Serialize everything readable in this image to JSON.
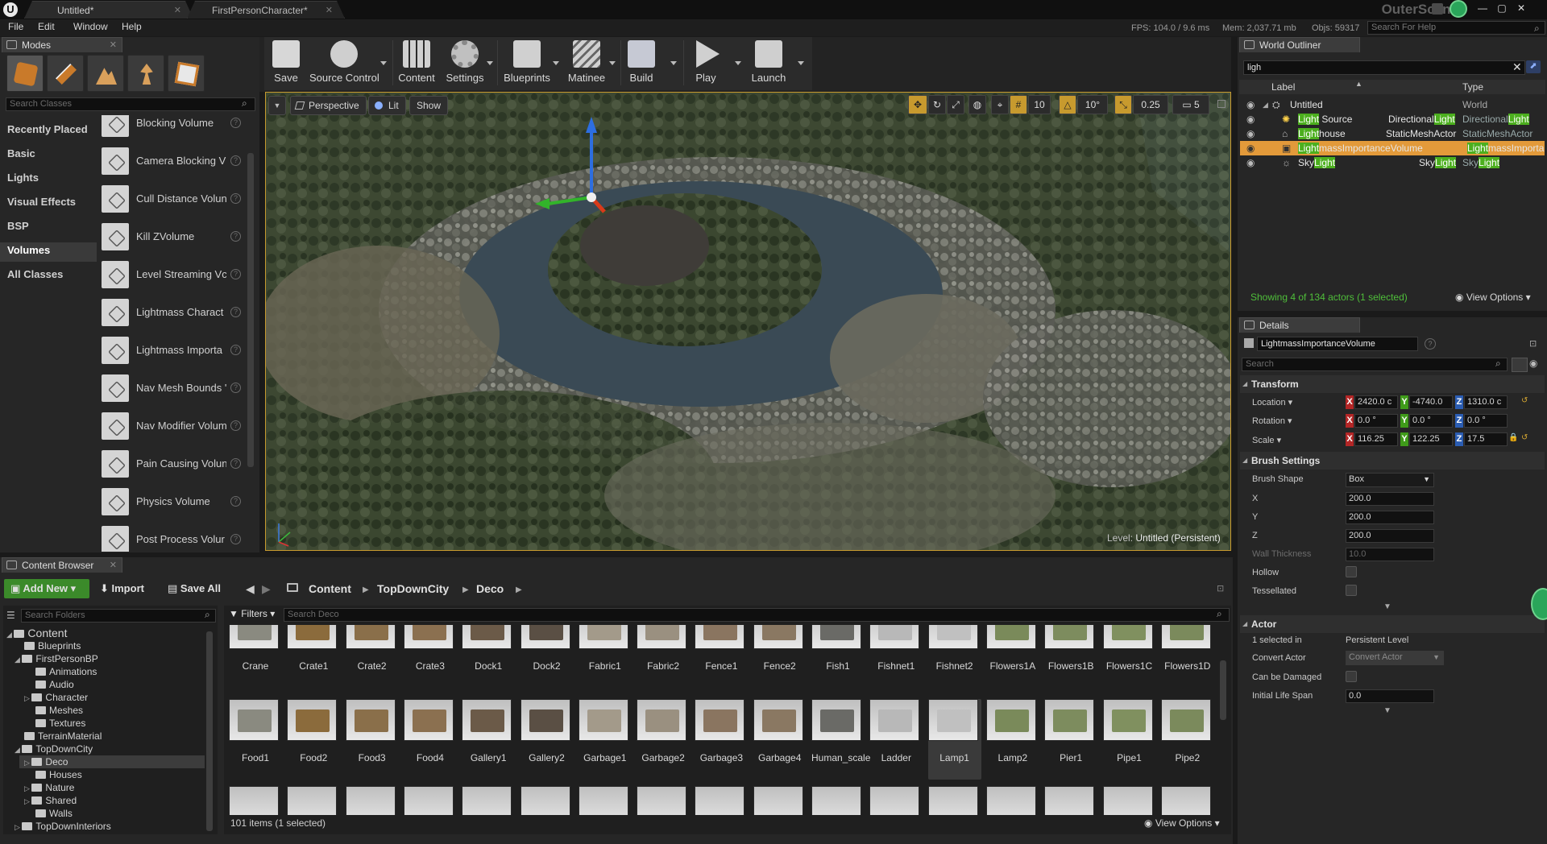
{
  "window": {
    "tabs": [
      "Untitled*",
      "FirstPersonCharacter*"
    ],
    "scene_name": "OuterScene",
    "controls": [
      "—",
      "▢",
      "✕"
    ]
  },
  "menu": [
    "File",
    "Edit",
    "Window",
    "Help"
  ],
  "stats": {
    "fps": "FPS: 104.0 / 9.6 ms",
    "mem": "Mem: 2,037.71 mb",
    "objs": "Objs: 59317"
  },
  "help_search": {
    "placeholder": "Search For Help"
  },
  "modes": {
    "tab": "Modes",
    "search_placeholder": "Search Classes",
    "categories": [
      "Recently Placed",
      "Basic",
      "Lights",
      "Visual Effects",
      "BSP",
      "Volumes",
      "All Classes"
    ],
    "active_category": "Volumes",
    "items": [
      "Blocking Volume",
      "Camera Blocking V",
      "Cull Distance Volun",
      "Kill ZVolume",
      "Level Streaming Vc",
      "Lightmass Charact",
      "Lightmass Importa",
      "Nav Mesh Bounds '",
      "Nav Modifier Volum",
      "Pain Causing Volun",
      "Physics Volume",
      "Post Process Volur"
    ]
  },
  "toolbar": {
    "buttons": [
      "Save",
      "Source Control",
      "Content",
      "Settings",
      "Blueprints",
      "Matinee",
      "Build",
      "Play",
      "Launch"
    ]
  },
  "viewport": {
    "perspective": "Perspective",
    "lit": "Lit",
    "show": "Show",
    "grid": "10",
    "angle": "10°",
    "scale": "0.25",
    "speed": "5",
    "level_prefix": "Level:",
    "level_name": "Untitled (Persistent)"
  },
  "outliner": {
    "tab": "World Outliner",
    "search_value": "ligh",
    "col_label": "Label",
    "col_type": "Type",
    "footer": "Showing 4 of 134 actors (1 selected)",
    "view_options": "View Options",
    "rows": [
      {
        "label": "Untitled",
        "type": "World"
      },
      {
        "label_hl": "Light",
        "label_rest": " Source",
        "type_pre": "Directional",
        "type_hl": "Light"
      },
      {
        "label_hl": "Light",
        "label_rest": "house",
        "type_plain": "StaticMeshActor"
      },
      {
        "label_hl": "Light",
        "label_rest": "massImportanceVolume",
        "type_pre": "",
        "type_hl": "Light",
        "type_post": "massImporta"
      },
      {
        "label_pre": "Sky",
        "label_hl": "Light",
        "type_pre": "Sky",
        "type_hl": "Light"
      }
    ]
  },
  "details": {
    "tab": "Details",
    "actor_name": "LightmassImportanceVolume",
    "search_placeholder": "Search",
    "transform": {
      "title": "Transform",
      "location_label": "Location",
      "rotation_label": "Rotation",
      "scale_label": "Scale",
      "location": [
        "2420.0 c",
        "-4740.0",
        "1310.0 c"
      ],
      "rotation": [
        "0.0 °",
        "0.0 °",
        "0.0 °"
      ],
      "scale": [
        "116.25",
        "122.25",
        "17.5"
      ]
    },
    "brush": {
      "title": "Brush Settings",
      "shape_label": "Brush Shape",
      "shape_value": "Box",
      "x_label": "X",
      "x": "200.0",
      "y_label": "Y",
      "y": "200.0",
      "z_label": "Z",
      "z": "200.0",
      "wall_label": "Wall Thickness",
      "wall": "10.0",
      "hollow_label": "Hollow",
      "tess_label": "Tessellated"
    },
    "actor": {
      "title": "Actor",
      "selected_label": "1 selected in",
      "selected_value": "Persistent Level",
      "convert_label": "Convert Actor",
      "convert_value": "Convert Actor",
      "damaged_label": "Can be Damaged",
      "life_label": "Initial Life Span",
      "life_value": "0.0"
    }
  },
  "content_browser": {
    "tab": "Content Browser",
    "add_new": "Add New",
    "import": "Import",
    "save_all": "Save All",
    "breadcrumb": [
      "Content",
      "TopDownCity",
      "Deco"
    ],
    "folder_search_placeholder": "Search Folders",
    "filters": "Filters",
    "asset_search_placeholder": "Search Deco",
    "folders": [
      {
        "name": "Content",
        "depth": 0
      },
      {
        "name": "Blueprints",
        "depth": 1
      },
      {
        "name": "FirstPersonBP",
        "depth": 1
      },
      {
        "name": "Animations",
        "depth": 2
      },
      {
        "name": "Audio",
        "depth": 2
      },
      {
        "name": "Character",
        "depth": 2
      },
      {
        "name": "Meshes",
        "depth": 2
      },
      {
        "name": "Textures",
        "depth": 2
      },
      {
        "name": "TerrainMaterial",
        "depth": 1
      },
      {
        "name": "TopDownCity",
        "depth": 1
      },
      {
        "name": "Deco",
        "depth": 2
      },
      {
        "name": "Houses",
        "depth": 2
      },
      {
        "name": "Nature",
        "depth": 2
      },
      {
        "name": "Shared",
        "depth": 2
      },
      {
        "name": "Walls",
        "depth": 2
      },
      {
        "name": "TopDownInteriors",
        "depth": 1
      }
    ],
    "row1": [
      "Crane",
      "Crate1",
      "Crate2",
      "Crate3",
      "Dock1",
      "Dock2",
      "Fabric1",
      "Fabric2",
      "Fence1",
      "Fence2",
      "Fish1",
      "Fishnet1",
      "Fishnet2",
      "Flowers1A",
      "Flowers1B",
      "Flowers1C",
      "Flowers1D"
    ],
    "row2": [
      "Food1",
      "Food2",
      "Food3",
      "Food4",
      "Gallery1",
      "Gallery2",
      "Garbage1",
      "Garbage2",
      "Garbage3",
      "Garbage4",
      "Human_scale",
      "Ladder",
      "Lamp1",
      "Lamp2",
      "Pier1",
      "Pipe1",
      "Pipe2"
    ],
    "selected_asset": "Lamp1",
    "footer": "101 items (1 selected)",
    "view_options": "View Options"
  }
}
